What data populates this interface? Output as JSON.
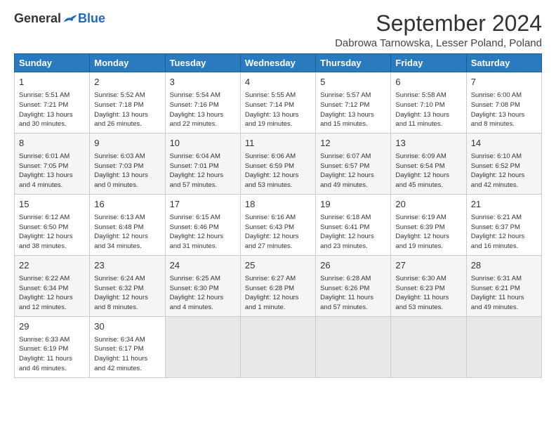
{
  "header": {
    "logo_general": "General",
    "logo_blue": "Blue",
    "title": "September 2024",
    "location": "Dabrowa Tarnowska, Lesser Poland, Poland"
  },
  "days_of_week": [
    "Sunday",
    "Monday",
    "Tuesday",
    "Wednesday",
    "Thursday",
    "Friday",
    "Saturday"
  ],
  "weeks": [
    [
      {
        "day": "1",
        "sunrise": "Sunrise: 5:51 AM",
        "sunset": "Sunset: 7:21 PM",
        "daylight": "Daylight: 13 hours and 30 minutes."
      },
      {
        "day": "2",
        "sunrise": "Sunrise: 5:52 AM",
        "sunset": "Sunset: 7:18 PM",
        "daylight": "Daylight: 13 hours and 26 minutes."
      },
      {
        "day": "3",
        "sunrise": "Sunrise: 5:54 AM",
        "sunset": "Sunset: 7:16 PM",
        "daylight": "Daylight: 13 hours and 22 minutes."
      },
      {
        "day": "4",
        "sunrise": "Sunrise: 5:55 AM",
        "sunset": "Sunset: 7:14 PM",
        "daylight": "Daylight: 13 hours and 19 minutes."
      },
      {
        "day": "5",
        "sunrise": "Sunrise: 5:57 AM",
        "sunset": "Sunset: 7:12 PM",
        "daylight": "Daylight: 13 hours and 15 minutes."
      },
      {
        "day": "6",
        "sunrise": "Sunrise: 5:58 AM",
        "sunset": "Sunset: 7:10 PM",
        "daylight": "Daylight: 13 hours and 11 minutes."
      },
      {
        "day": "7",
        "sunrise": "Sunrise: 6:00 AM",
        "sunset": "Sunset: 7:08 PM",
        "daylight": "Daylight: 13 hours and 8 minutes."
      }
    ],
    [
      {
        "day": "8",
        "sunrise": "Sunrise: 6:01 AM",
        "sunset": "Sunset: 7:05 PM",
        "daylight": "Daylight: 13 hours and 4 minutes."
      },
      {
        "day": "9",
        "sunrise": "Sunrise: 6:03 AM",
        "sunset": "Sunset: 7:03 PM",
        "daylight": "Daylight: 13 hours and 0 minutes."
      },
      {
        "day": "10",
        "sunrise": "Sunrise: 6:04 AM",
        "sunset": "Sunset: 7:01 PM",
        "daylight": "Daylight: 12 hours and 57 minutes."
      },
      {
        "day": "11",
        "sunrise": "Sunrise: 6:06 AM",
        "sunset": "Sunset: 6:59 PM",
        "daylight": "Daylight: 12 hours and 53 minutes."
      },
      {
        "day": "12",
        "sunrise": "Sunrise: 6:07 AM",
        "sunset": "Sunset: 6:57 PM",
        "daylight": "Daylight: 12 hours and 49 minutes."
      },
      {
        "day": "13",
        "sunrise": "Sunrise: 6:09 AM",
        "sunset": "Sunset: 6:54 PM",
        "daylight": "Daylight: 12 hours and 45 minutes."
      },
      {
        "day": "14",
        "sunrise": "Sunrise: 6:10 AM",
        "sunset": "Sunset: 6:52 PM",
        "daylight": "Daylight: 12 hours and 42 minutes."
      }
    ],
    [
      {
        "day": "15",
        "sunrise": "Sunrise: 6:12 AM",
        "sunset": "Sunset: 6:50 PM",
        "daylight": "Daylight: 12 hours and 38 minutes."
      },
      {
        "day": "16",
        "sunrise": "Sunrise: 6:13 AM",
        "sunset": "Sunset: 6:48 PM",
        "daylight": "Daylight: 12 hours and 34 minutes."
      },
      {
        "day": "17",
        "sunrise": "Sunrise: 6:15 AM",
        "sunset": "Sunset: 6:46 PM",
        "daylight": "Daylight: 12 hours and 31 minutes."
      },
      {
        "day": "18",
        "sunrise": "Sunrise: 6:16 AM",
        "sunset": "Sunset: 6:43 PM",
        "daylight": "Daylight: 12 hours and 27 minutes."
      },
      {
        "day": "19",
        "sunrise": "Sunrise: 6:18 AM",
        "sunset": "Sunset: 6:41 PM",
        "daylight": "Daylight: 12 hours and 23 minutes."
      },
      {
        "day": "20",
        "sunrise": "Sunrise: 6:19 AM",
        "sunset": "Sunset: 6:39 PM",
        "daylight": "Daylight: 12 hours and 19 minutes."
      },
      {
        "day": "21",
        "sunrise": "Sunrise: 6:21 AM",
        "sunset": "Sunset: 6:37 PM",
        "daylight": "Daylight: 12 hours and 16 minutes."
      }
    ],
    [
      {
        "day": "22",
        "sunrise": "Sunrise: 6:22 AM",
        "sunset": "Sunset: 6:34 PM",
        "daylight": "Daylight: 12 hours and 12 minutes."
      },
      {
        "day": "23",
        "sunrise": "Sunrise: 6:24 AM",
        "sunset": "Sunset: 6:32 PM",
        "daylight": "Daylight: 12 hours and 8 minutes."
      },
      {
        "day": "24",
        "sunrise": "Sunrise: 6:25 AM",
        "sunset": "Sunset: 6:30 PM",
        "daylight": "Daylight: 12 hours and 4 minutes."
      },
      {
        "day": "25",
        "sunrise": "Sunrise: 6:27 AM",
        "sunset": "Sunset: 6:28 PM",
        "daylight": "Daylight: 12 hours and 1 minute."
      },
      {
        "day": "26",
        "sunrise": "Sunrise: 6:28 AM",
        "sunset": "Sunset: 6:26 PM",
        "daylight": "Daylight: 11 hours and 57 minutes."
      },
      {
        "day": "27",
        "sunrise": "Sunrise: 6:30 AM",
        "sunset": "Sunset: 6:23 PM",
        "daylight": "Daylight: 11 hours and 53 minutes."
      },
      {
        "day": "28",
        "sunrise": "Sunrise: 6:31 AM",
        "sunset": "Sunset: 6:21 PM",
        "daylight": "Daylight: 11 hours and 49 minutes."
      }
    ],
    [
      {
        "day": "29",
        "sunrise": "Sunrise: 6:33 AM",
        "sunset": "Sunset: 6:19 PM",
        "daylight": "Daylight: 11 hours and 46 minutes."
      },
      {
        "day": "30",
        "sunrise": "Sunrise: 6:34 AM",
        "sunset": "Sunset: 6:17 PM",
        "daylight": "Daylight: 11 hours and 42 minutes."
      },
      null,
      null,
      null,
      null,
      null
    ]
  ]
}
